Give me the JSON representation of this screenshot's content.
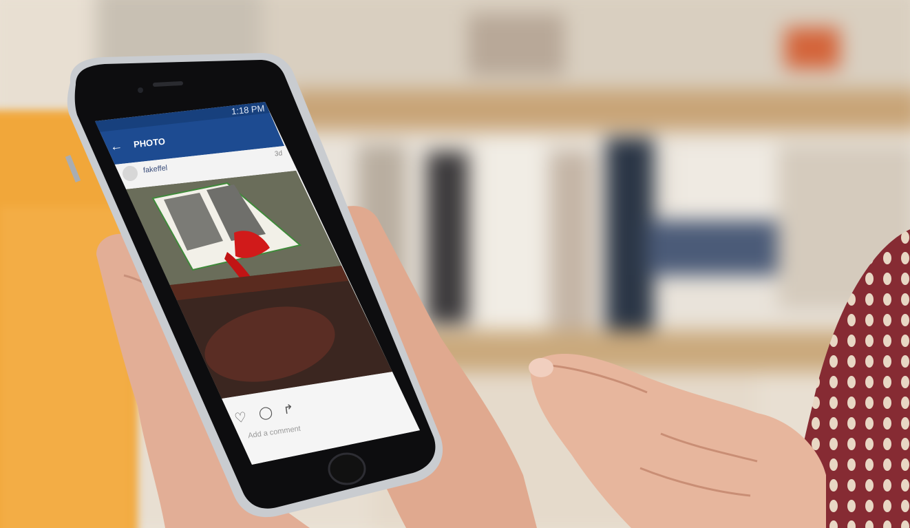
{
  "status_bar": {
    "time": "1:18 PM"
  },
  "header": {
    "title": "PHOTO",
    "back_icon": "arrow-left-icon"
  },
  "post": {
    "username": "fakeffel",
    "age": "3d",
    "comment_placeholder": "Add a comment",
    "actions": [
      "heart-icon",
      "comment-icon",
      "share-icon"
    ]
  },
  "colors": {
    "app_bar": "#1d4b91",
    "ribbon": "#d11a1a",
    "background_shelf": "#d8b890",
    "sweater": "#8a2f35",
    "mug": "#f2a93a"
  }
}
